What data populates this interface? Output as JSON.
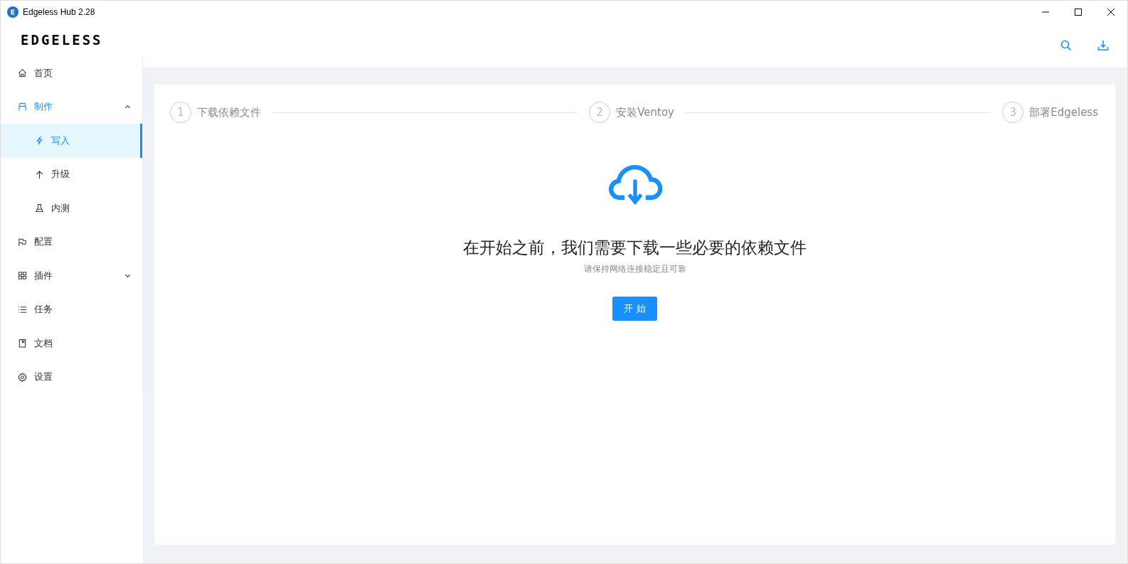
{
  "window": {
    "title": "Edgeless Hub 2.28"
  },
  "logo": "EDGELESS",
  "sidebar": {
    "items": [
      {
        "label": "首页",
        "selected": false
      },
      {
        "label": "制作",
        "selected": false,
        "expanded": true,
        "children": [
          {
            "label": "写入",
            "selected": true
          },
          {
            "label": "升级",
            "selected": false
          },
          {
            "label": "内测",
            "selected": false
          }
        ]
      },
      {
        "label": "配置",
        "selected": false
      },
      {
        "label": "插件",
        "selected": false,
        "expanded": false
      },
      {
        "label": "任务",
        "selected": false
      },
      {
        "label": "文档",
        "selected": false
      },
      {
        "label": "设置",
        "selected": false
      }
    ]
  },
  "steps": [
    {
      "number": "1",
      "label": "下载依赖文件"
    },
    {
      "number": "2",
      "label": "安装Ventoy"
    },
    {
      "number": "3",
      "label": "部署Edgeless"
    }
  ],
  "content": {
    "heading": "在开始之前，我们需要下载一些必要的依赖文件",
    "subtitle": "请保持网络连接稳定且可靠",
    "button": "开 始"
  }
}
